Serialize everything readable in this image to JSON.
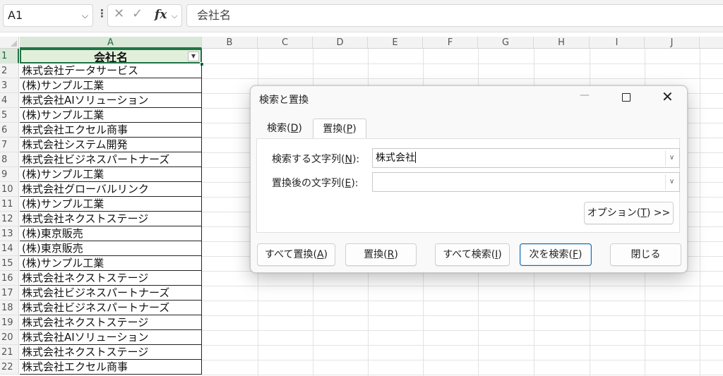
{
  "formula_bar": {
    "name_box": "A1",
    "cell_content": "会社名"
  },
  "columns": [
    "A",
    "B",
    "C",
    "D",
    "E",
    "F",
    "G",
    "H",
    "I",
    "J"
  ],
  "header_cell": "会社名",
  "rows": [
    {
      "num": "1",
      "value": "会社名"
    },
    {
      "num": "2",
      "value": "株式会社データサービス"
    },
    {
      "num": "3",
      "value": "(株)サンプル工業"
    },
    {
      "num": "4",
      "value": "株式会社AIソリューション"
    },
    {
      "num": "5",
      "value": "(株)サンプル工業"
    },
    {
      "num": "6",
      "value": "株式会社エクセル商事"
    },
    {
      "num": "7",
      "value": "株式会社システム開発"
    },
    {
      "num": "8",
      "value": "株式会社ビジネスパートナーズ"
    },
    {
      "num": "9",
      "value": "(株)サンプル工業"
    },
    {
      "num": "10",
      "value": "株式会社グローバルリンク"
    },
    {
      "num": "11",
      "value": "(株)サンプル工業"
    },
    {
      "num": "12",
      "value": "株式会社ネクストステージ"
    },
    {
      "num": "13",
      "value": "(株)東京販売"
    },
    {
      "num": "14",
      "value": "(株)東京販売"
    },
    {
      "num": "15",
      "value": "(株)サンプル工業"
    },
    {
      "num": "16",
      "value": "株式会社ネクストステージ"
    },
    {
      "num": "17",
      "value": "株式会社ビジネスパートナーズ"
    },
    {
      "num": "18",
      "value": "株式会社ビジネスパートナーズ"
    },
    {
      "num": "19",
      "value": "株式会社ネクストステージ"
    },
    {
      "num": "20",
      "value": "株式会社AIソリューション"
    },
    {
      "num": "21",
      "value": "株式会社ネクストステージ"
    },
    {
      "num": "22",
      "value": "株式会社エクセル商事"
    }
  ],
  "dialog": {
    "title": "検索と置換",
    "tabs": {
      "search": {
        "text": "検索(",
        "key": "D",
        "end": ")"
      },
      "replace": {
        "text": "置換(",
        "key": "P",
        "end": ")"
      }
    },
    "find_label": {
      "text": "検索する文字列(",
      "key": "N",
      "end": "):"
    },
    "find_value": "株式会社",
    "replace_label": {
      "text": "置換後の文字列(",
      "key": "E",
      "end": "):"
    },
    "replace_value": "",
    "options_button": {
      "text": "オプション(",
      "key": "T",
      "end": ") >>"
    },
    "buttons": {
      "replace_all": {
        "text": "すべて置換(",
        "key": "A",
        "end": ")"
      },
      "replace": {
        "text": "置換(",
        "key": "R",
        "end": ")"
      },
      "find_all": {
        "text": "すべて検索(",
        "key": "I",
        "end": ")"
      },
      "find_next": {
        "text": "次を検索(",
        "key": "F",
        "end": ")"
      },
      "close": "閉じる"
    }
  },
  "colors": {
    "accent_green": "#217346",
    "header_fill": "#e2efda",
    "primary_button_border": "#0f6cbd"
  }
}
